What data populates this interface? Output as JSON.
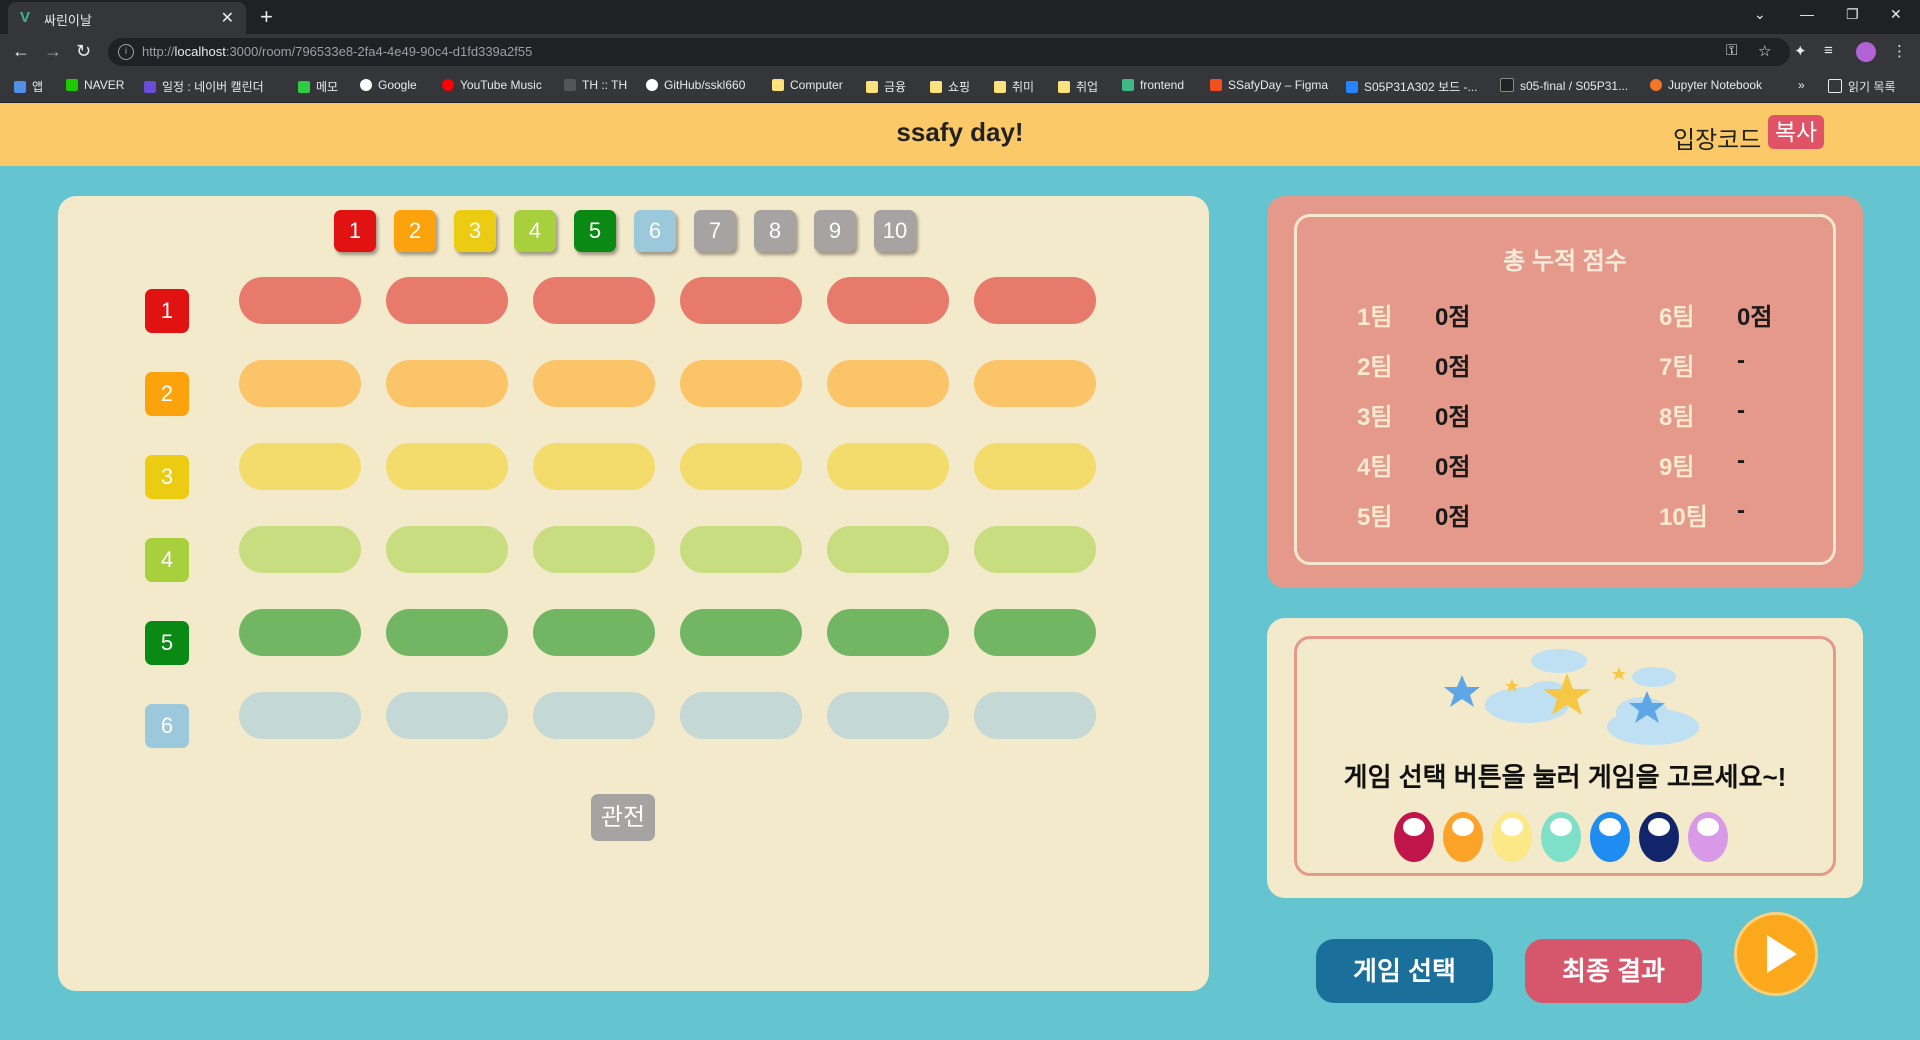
{
  "browser": {
    "tab_title": "싸린이날",
    "url_prefix": "http://",
    "url_host": "localhost",
    "url_rest": ":3000/room/796533e8-2fa4-4e49-90c4-d1fd339a2f55",
    "bookmarks": [
      "앱",
      "NAVER",
      "일정 : 네이버 캘린더",
      "메모",
      "Google",
      "YouTube Music",
      "TH :: TH",
      "GitHub/sskl660",
      "Computer",
      "금융",
      "쇼핑",
      "취미",
      "취업",
      "frontend",
      "SSafyDay – Figma",
      "S05P31A302 보드 -...",
      "s05-final / S05P31...",
      "Jupyter Notebook",
      "»",
      "읽기 목록"
    ]
  },
  "header": {
    "logo": "ssafy day!",
    "code_label": "입장코드",
    "copy_label": "복사"
  },
  "board": {
    "team_tabs": [
      {
        "label": "1",
        "color": "#e01212"
      },
      {
        "label": "2",
        "color": "#fca20c"
      },
      {
        "label": "3",
        "color": "#eccc12"
      },
      {
        "label": "4",
        "color": "#a7d03c"
      },
      {
        "label": "5",
        "color": "#0a8a14"
      },
      {
        "label": "6",
        "color": "#9cc8dc"
      },
      {
        "label": "7",
        "color": "#a8a3a3"
      },
      {
        "label": "8",
        "color": "#a8a3a3"
      },
      {
        "label": "9",
        "color": "#a8a3a3"
      },
      {
        "label": "10",
        "color": "#a8a3a3"
      }
    ],
    "rows": [
      {
        "label": "1",
        "color": "#e01212",
        "seat_color": "#e87a6c"
      },
      {
        "label": "2",
        "color": "#fca20c",
        "seat_color": "#fcc468"
      },
      {
        "label": "3",
        "color": "#eccc12",
        "seat_color": "#f3dc6c"
      },
      {
        "label": "4",
        "color": "#a7d03c",
        "seat_color": "#c8dd80"
      },
      {
        "label": "5",
        "color": "#0a8a14",
        "seat_color": "#72b664"
      },
      {
        "label": "6",
        "color": "#9cc8dc",
        "seat_color": "#c4d8d6"
      }
    ],
    "seats_per_row": 6,
    "spectate_label": "관전"
  },
  "scores": {
    "title": "총 누적 점수",
    "left": [
      {
        "team": "1팀",
        "points": "0점"
      },
      {
        "team": "2팀",
        "points": "0점"
      },
      {
        "team": "3팀",
        "points": "0점"
      },
      {
        "team": "4팀",
        "points": "0점"
      },
      {
        "team": "5팀",
        "points": "0점"
      }
    ],
    "right": [
      {
        "team": "6팀",
        "points": "0점"
      },
      {
        "team": "7팀",
        "points": "-"
      },
      {
        "team": "8팀",
        "points": "-"
      },
      {
        "team": "9팀",
        "points": "-"
      },
      {
        "team": "10팀",
        "points": "-"
      }
    ]
  },
  "guide": {
    "message": "게임 선택 버튼을 눌러 게임을 고르세요~!",
    "characters": [
      "#c0154a",
      "#fca328",
      "#fce886",
      "#7ee0c8",
      "#1e8cf0",
      "#12246a",
      "#d89ae6"
    ]
  },
  "actions": {
    "select_game": "게임 선택",
    "final_result": "최종 결과"
  }
}
